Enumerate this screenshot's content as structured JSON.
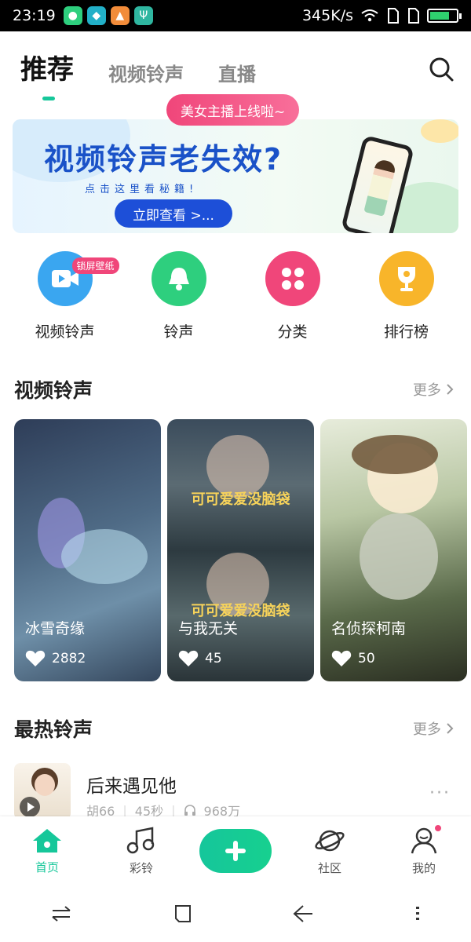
{
  "status_bar": {
    "time": "23:19",
    "network_speed": "345K/s",
    "battery_level": 0.75,
    "app_icons": [
      "app-green-icon",
      "app-teal-icon",
      "app-photo-icon",
      "usb-icon"
    ]
  },
  "top_tabs": [
    {
      "label": "推荐",
      "active": true
    },
    {
      "label": "视频铃声",
      "active": false
    },
    {
      "label": "直播",
      "active": false
    }
  ],
  "live_badge": "美女主播上线啦~",
  "banner": {
    "title": "视频铃声老失效?",
    "subtitle": "点击这里看秘籍!",
    "button": "立即查看 >..."
  },
  "categories": [
    {
      "label": "视频铃声",
      "badge": "锁屏壁纸",
      "color": "#3aa6f0",
      "icon": "video-icon"
    },
    {
      "label": "铃声",
      "color": "#2ecf7e",
      "icon": "bell-icon"
    },
    {
      "label": "分类",
      "color": "#f0467a",
      "icon": "grid-icon"
    },
    {
      "label": "排行榜",
      "color": "#f8b52a",
      "icon": "trophy-icon"
    }
  ],
  "video_section": {
    "title": "视频铃声",
    "more": "更多",
    "items": [
      {
        "title": "冰雪奇缘",
        "likes": "2882"
      },
      {
        "title": "与我无关",
        "likes": "45",
        "overlay_top": "可可爱爱没脑袋",
        "overlay_bottom": "可可爱爱没脑袋"
      },
      {
        "title": "名侦探柯南",
        "likes": "50"
      }
    ]
  },
  "hot_section": {
    "title": "最热铃声",
    "more": "更多",
    "items": [
      {
        "title": "后来遇见他",
        "artist": "胡66",
        "duration": "45秒",
        "plays": "968万"
      }
    ]
  },
  "bottom_nav": [
    {
      "label": "首页",
      "icon": "home-icon",
      "active": true
    },
    {
      "label": "彩铃",
      "icon": "music-note-icon",
      "active": false
    },
    {
      "label": "",
      "icon": "plus-icon",
      "active": false
    },
    {
      "label": "社区",
      "icon": "planet-icon",
      "active": false
    },
    {
      "label": "我的",
      "icon": "profile-icon",
      "active": false
    }
  ],
  "colors": {
    "accent": "#16c79a",
    "pink": "#f0467a",
    "banner_blue": "#1a52c8"
  }
}
